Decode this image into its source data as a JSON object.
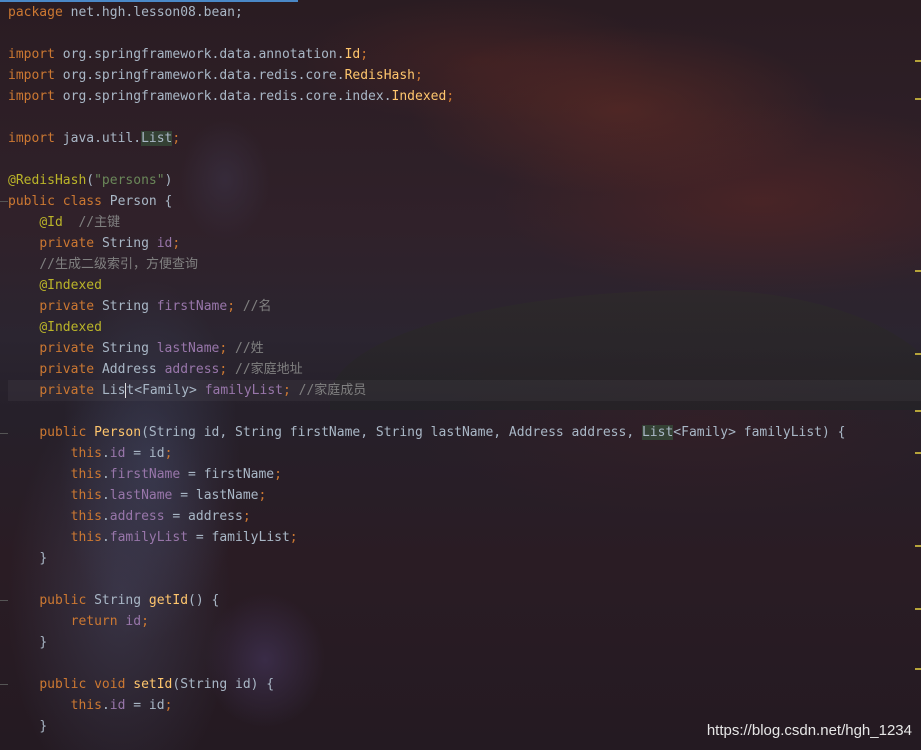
{
  "code": {
    "package_kw": "package",
    "package_name": " net.hgh.lesson08.bean;",
    "import_kw": "import",
    "import1_path": " org.springframework.data.annotation.",
    "import1_cls": "Id",
    "import2_path": " org.springframework.data.redis.core.",
    "import2_cls": "RedisHash",
    "import3_path": " org.springframework.data.redis.core.index.",
    "import3_cls": "Indexed",
    "import4_path": " java.util.",
    "import4_cls": "List",
    "semicolon": ";",
    "redishash_ann": "@RedisHash",
    "paren_open": "(",
    "paren_close": ")",
    "persons_str": "\"persons\"",
    "public_kw": "public",
    "class_kw": "class",
    "class_name": "Person",
    "brace_open": " {",
    "brace_close": "}",
    "id_ann": "@Id",
    "comment_key": "//主键",
    "private_kw": "private",
    "string_type": "String",
    "field_id": "id",
    "comment_index": "//生成二级索引，方便查询",
    "indexed_ann": "@Indexed",
    "field_firstname": "firstName",
    "comment_name": "//名",
    "field_lastname": "lastName",
    "comment_surname": "//姓",
    "address_type": "Address",
    "field_address": "address",
    "comment_address": "//家庭地址",
    "list_type_a": "Lis",
    "list_type_b": "t",
    "family_generic": "<Family>",
    "field_familylist": "familyList",
    "comment_family": "//家庭成员",
    "ctor_params_1": "(String id, String firstName, String lastName, Address address, ",
    "list_type": "List",
    "ctor_params_2": "<Family> familyList) {",
    "this_kw": "this",
    "assign_id": " = id",
    "assign_firstname": " = firstName",
    "assign_lastname": " = lastName",
    "assign_address": " = address",
    "assign_familylist": " = familyList",
    "getid_name": "getId",
    "getid_params": "() {",
    "return_kw": "return",
    "void_kw": "void",
    "setid_name": "setId",
    "setid_params": "(String id) {"
  },
  "watermark": "https://blog.csdn.net/hgh_1234",
  "colors": {
    "keyword": "#cc7832",
    "annotation": "#bbb529",
    "string": "#6a8759",
    "comment": "#808080",
    "field": "#9876aa",
    "method": "#ffc66d",
    "text": "#a9b7c6"
  }
}
